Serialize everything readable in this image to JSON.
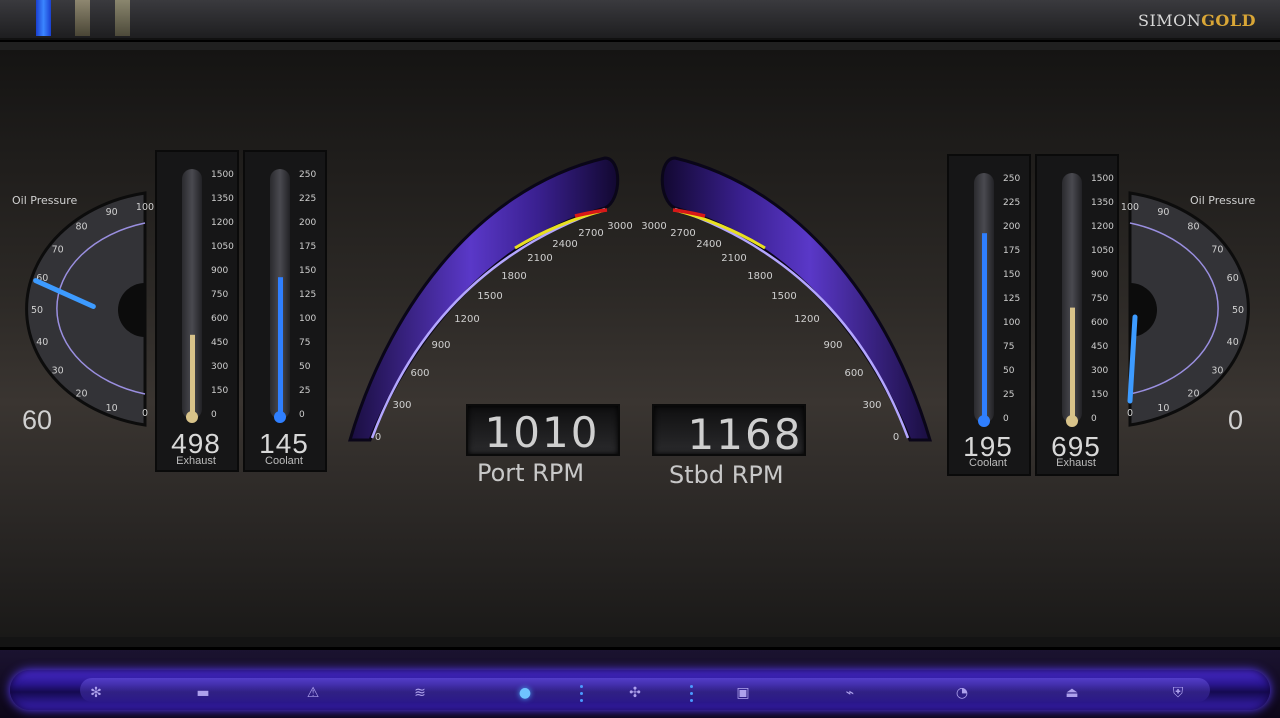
{
  "brand": {
    "simon": "SIMON",
    "gold": "GOLD"
  },
  "left": {
    "oil_title": "Oil Pressure",
    "oil_readout": "60",
    "oil_ticks": [
      "0",
      "10",
      "20",
      "30",
      "40",
      "50",
      "60",
      "70",
      "80",
      "90",
      "100"
    ],
    "oil_value": 60,
    "exhaust_value": "498",
    "exhaust_label": "Exhaust",
    "exhaust_fill": 0.33,
    "exhaust_ticks": [
      "0",
      "150",
      "300",
      "450",
      "600",
      "750",
      "900",
      "1050",
      "1200",
      "1350",
      "1500"
    ],
    "coolant_value": "145",
    "coolant_label": "Coolant",
    "coolant_fill": 0.57,
    "coolant_ticks": [
      "0",
      "25",
      "50",
      "75",
      "100",
      "125",
      "150",
      "175",
      "200",
      "225",
      "250"
    ]
  },
  "right": {
    "oil_title": "Oil Pressure",
    "oil_readout": "0",
    "oil_ticks": [
      "0",
      "10",
      "20",
      "30",
      "40",
      "50",
      "60",
      "70",
      "80",
      "90",
      "100"
    ],
    "oil_value": 0,
    "exhaust_value": "695",
    "exhaust_label": "Exhaust",
    "exhaust_fill": 0.46,
    "exhaust_ticks": [
      "0",
      "150",
      "300",
      "450",
      "600",
      "750",
      "900",
      "1050",
      "1200",
      "1350",
      "1500"
    ],
    "coolant_value": "195",
    "coolant_label": "Coolant",
    "coolant_fill": 0.77,
    "coolant_ticks": [
      "0",
      "25",
      "50",
      "75",
      "100",
      "125",
      "150",
      "175",
      "200",
      "225",
      "250"
    ]
  },
  "rpm": {
    "ticks": [
      "0",
      "300",
      "600",
      "900",
      "1200",
      "1500",
      "1800",
      "2100",
      "2400",
      "2700",
      "3000"
    ],
    "port_value": "1010",
    "port_label": "Port RPM",
    "stbd_value": "1168",
    "stbd_label": "Stbd RPM"
  },
  "colors": {
    "needle": "#3d9bff",
    "arc_fill": "#b3a6ff",
    "yellow": "#e8e020",
    "red": "#d81818",
    "tube_violet": "#4a2a9a"
  },
  "nav_icons": [
    "fan-icon",
    "battery-icon",
    "warning-icon",
    "waves-icon",
    "gauge-active-icon",
    "propeller-icon",
    "engine-icon",
    "plug-icon",
    "pump-icon",
    "boat-icon",
    "shield-icon"
  ]
}
